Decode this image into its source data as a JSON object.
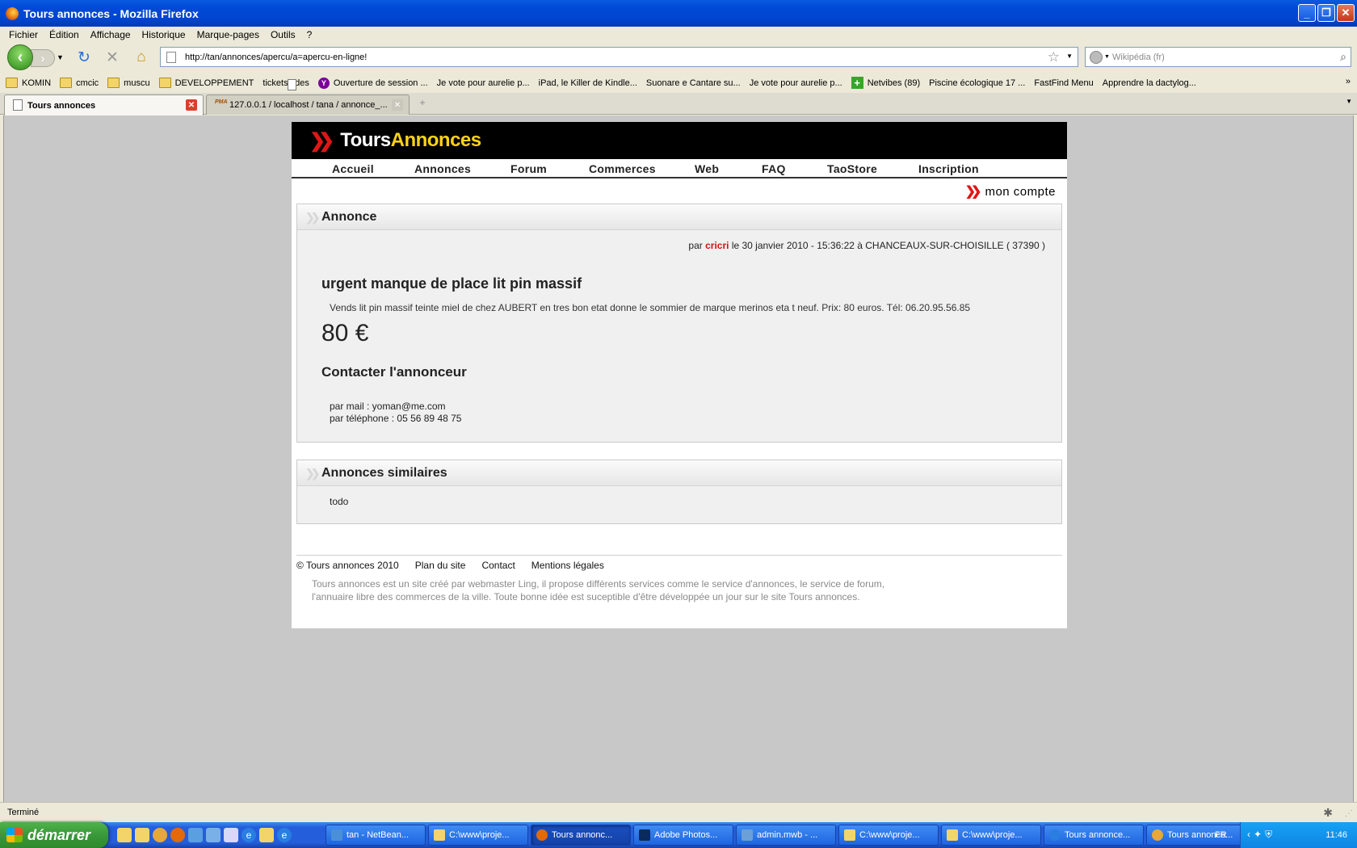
{
  "window": {
    "title": "Tours annonces - Mozilla Firefox"
  },
  "menu": [
    "Fichier",
    "Édition",
    "Affichage",
    "Historique",
    "Marque-pages",
    "Outils",
    "?"
  ],
  "url": "http://tan/annonces/apercu/a=apercu-en-ligne!",
  "search_placeholder": "Wikipédia (fr)",
  "bookmarks": [
    {
      "label": "KOMIN",
      "icon": "folder-icon"
    },
    {
      "label": "cmcic",
      "icon": "folder-icon"
    },
    {
      "label": "muscu",
      "icon": "folder-icon"
    },
    {
      "label": "DEVELOPPEMENT",
      "icon": "folder-icon"
    },
    {
      "label": "ticketsoldes",
      "icon": "page-icon"
    },
    {
      "label": "Ouverture de session ...",
      "icon": "yahoo-icon"
    },
    {
      "label": "Je vote pour aurelie p...",
      "icon": "page-icon"
    },
    {
      "label": "iPad, le Killer de Kindle...",
      "icon": "page-icon"
    },
    {
      "label": "Suonare e Cantare su...",
      "icon": "page-icon"
    },
    {
      "label": "Je vote pour aurelie p...",
      "icon": "page-icon"
    },
    {
      "label": "Netvibes (89)",
      "icon": "netvibes-icon"
    },
    {
      "label": "Piscine écologique 17 ...",
      "icon": "page-icon"
    },
    {
      "label": "FastFind Menu",
      "icon": "page-icon"
    },
    {
      "label": "Apprendre la dactylog...",
      "icon": "page-icon"
    }
  ],
  "tabs": [
    {
      "label": "Tours annonces",
      "active": true
    },
    {
      "label": "127.0.0.1 / localhost / tana / annonce_...",
      "active": false
    }
  ],
  "site": {
    "logo_part1": "Tours",
    "logo_part2": "Annonces",
    "nav": [
      "Accueil",
      "Annonces",
      "Forum",
      "Commerces",
      "Web",
      "FAQ",
      "TaoStore",
      "Inscription"
    ],
    "account": "mon compte"
  },
  "annonce": {
    "header": "Annonce",
    "meta_prefix": "par",
    "author": "cricri",
    "meta_suffix": "le 30 janvier 2010 - 15:36:22 à CHANCEAUX-SUR-CHOISILLE ( 37390 )",
    "title": "urgent manque de place lit pin massif",
    "description": "Vends lit pin massif teinte miel de chez AUBERT en tres bon etat donne le sommier de marque merinos eta t neuf. Prix: 80 euros. Tél: 06.20.95.56.85",
    "price": "80 €",
    "contact_title": "Contacter l'annonceur",
    "contact_mail": "par mail : yoman@me.com",
    "contact_phone": "par téléphone : 05 56 89 48 75"
  },
  "similaires": {
    "header": "Annonces similaires",
    "content": "todo"
  },
  "footer": {
    "links": [
      "© Tours annonces 2010",
      "Plan du site",
      "Contact",
      "Mentions légales"
    ],
    "description": "Tours annonces est un site créé par webmaster Ling, il propose différents services comme le service d'annonces, le service de forum, l'annuaire libre des commerces de la ville. Toute bonne idée est suceptible d'être développée un jour sur le site Tours annonces."
  },
  "status": "Terminé",
  "taskbar": {
    "start": "démarrer",
    "tasks": [
      {
        "label": "tan - NetBean...",
        "icon_color": "#4a90d9"
      },
      {
        "label": "C:\\www\\proje...",
        "icon_color": "#f3d46b"
      },
      {
        "label": "Tours annonc...",
        "icon_color": "#e26a0b",
        "active": true
      },
      {
        "label": "Adobe Photos...",
        "icon_color": "#0a2a5e"
      },
      {
        "label": "admin.mwb - ...",
        "icon_color": "#6aa0d8"
      },
      {
        "label": "C:\\www\\proje...",
        "icon_color": "#f3d46b"
      },
      {
        "label": "C:\\www\\proje...",
        "icon_color": "#f3d46b"
      },
      {
        "label": "Tours annonce...",
        "icon_color": "#2a7de1"
      },
      {
        "label": "Tours annonce...",
        "icon_color": "#e26a0b"
      }
    ],
    "lang": "FR",
    "clock": "11:46"
  }
}
